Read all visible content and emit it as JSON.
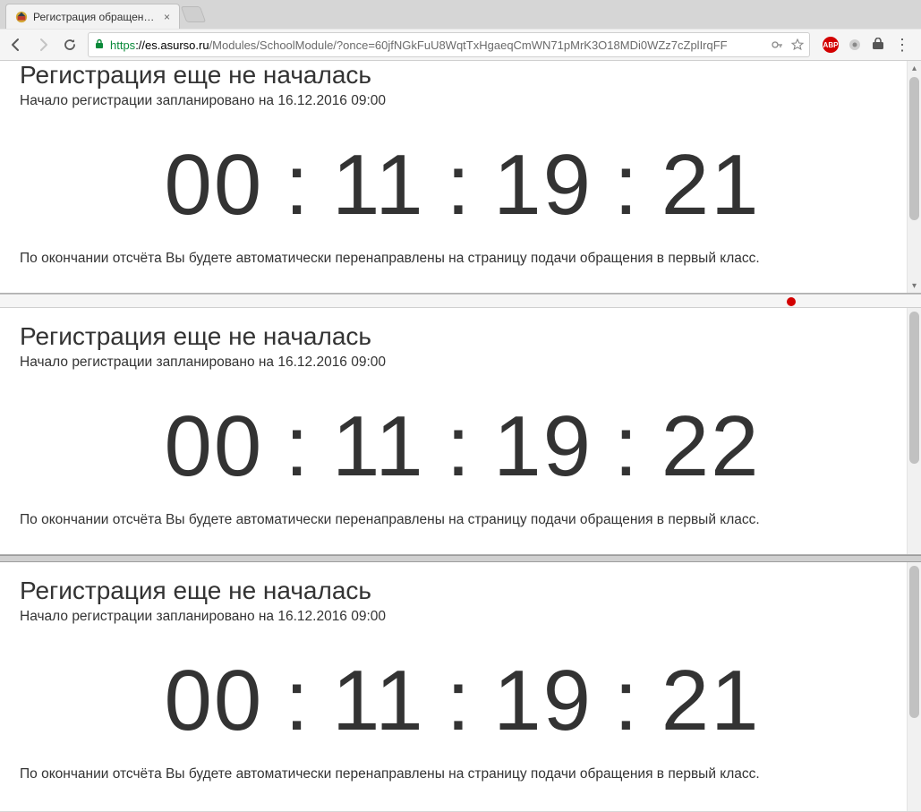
{
  "browser": {
    "tab_title": "Регистрация обращений в",
    "url_scheme": "https",
    "url_host": "://es.asurso.ru",
    "url_path": "/Modules/SchoolModule/?once=60jfNGkFuU8WqtTxHgaeqCmWN71pMrK3O18MDi0WZz7cZplIrqFF",
    "abp_label": "ABP"
  },
  "windows": [
    {
      "heading": "Регистрация еще не началась",
      "subline": "Начало регистрации запланировано на 16.12.2016 09:00",
      "countdown": {
        "d": "00",
        "h": "11",
        "m": "19",
        "s": "21"
      },
      "footnote": "По окончании отсчёта Вы будете автоматически перенаправлены на страницу подачи обращения в первый класс."
    },
    {
      "heading": "Регистрация еще не началась",
      "subline": "Начало регистрации запланировано на 16.12.2016 09:00",
      "countdown": {
        "d": "00",
        "h": "11",
        "m": "19",
        "s": "22"
      },
      "footnote": "По окончании отсчёта Вы будете автоматически перенаправлены на страницу подачи обращения в первый класс."
    },
    {
      "heading": "Регистрация еще не началась",
      "subline": "Начало регистрации запланировано на 16.12.2016 09:00",
      "countdown": {
        "d": "00",
        "h": "11",
        "m": "19",
        "s": "21"
      },
      "footnote": "По окончании отсчёта Вы будете автоматически перенаправлены на страницу подачи обращения в первый класс."
    }
  ],
  "sep": ":"
}
